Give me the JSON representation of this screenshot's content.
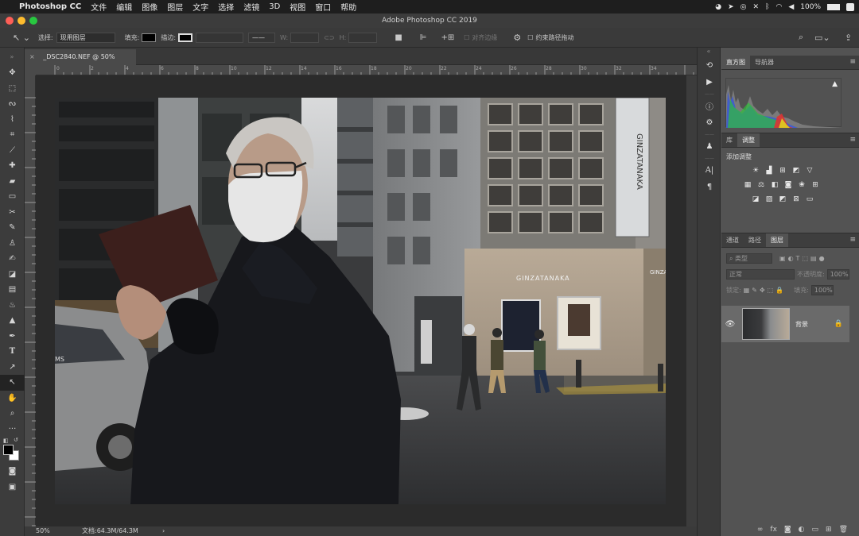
{
  "menubar": {
    "apple": "",
    "app_name": "Photoshop CC",
    "items": [
      "文件",
      "编辑",
      "图像",
      "图层",
      "文字",
      "选择",
      "滤镜",
      "3D",
      "视图",
      "窗口",
      "帮助"
    ],
    "battery": "100%"
  },
  "window": {
    "title": "Adobe Photoshop CC 2019"
  },
  "options": {
    "select_label": "选择:",
    "select_value": "现用图层",
    "fill_label": "填充:",
    "stroke_label": "描边:",
    "w_label": "W:",
    "h_label": "H:",
    "align_edges": "对齐边缘",
    "constrain_path": "约束路径拖动"
  },
  "document": {
    "tab_close": "×",
    "tab_title": "_DSC2840.NEF @ 50%(RGB/16*)",
    "zoom": "50%",
    "doc_info": "文档:64.3M/64.3M",
    "ruler_ticks": [
      "0",
      "2",
      "4",
      "6",
      "8",
      "10",
      "12",
      "14",
      "16",
      "18",
      "20",
      "22",
      "24",
      "26",
      "28",
      "30",
      "32",
      "34"
    ]
  },
  "photo_signs": {
    "vertical_sign": "GINZATANAKA",
    "storefront_sign": "GINZATANAKA",
    "truck_text": "MS",
    "right_sign": "GINZA"
  },
  "panels": {
    "histogram_tabs": [
      "直方图",
      "导航器"
    ],
    "adjust_tabs": [
      "库",
      "调整"
    ],
    "add_adjustment": "添加调整",
    "layers_tabs": [
      "通道",
      "路径",
      "图层"
    ],
    "kind_filter": "类型",
    "blend_mode": "正常",
    "opacity_label": "不透明度:",
    "opacity_value": "100%",
    "lock_label": "锁定:",
    "fill_label": "填充:",
    "fill_value": "100%",
    "layer_name": "背景"
  },
  "colors": {
    "accent": "#535353",
    "canvas_bg": "#2b2b2b",
    "foreground": "#000000",
    "background": "#ffffff"
  }
}
